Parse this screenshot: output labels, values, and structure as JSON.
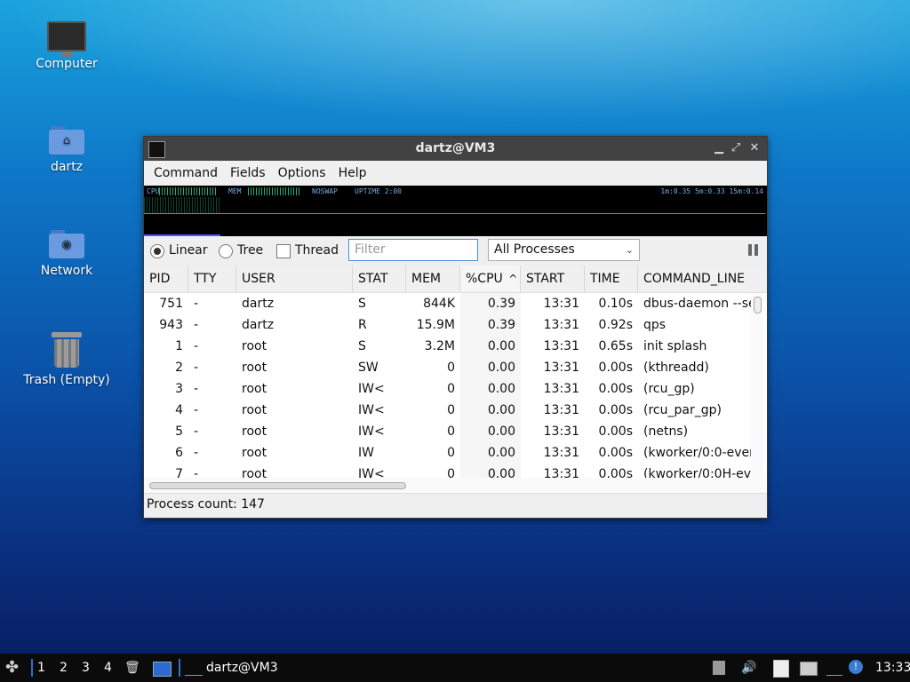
{
  "desktop": {
    "icons": [
      {
        "label": "Computer",
        "icon": "computer-icon"
      },
      {
        "label": "dartz",
        "icon": "home-folder-icon"
      },
      {
        "label": "Network",
        "icon": "network-folder-icon"
      },
      {
        "label": "Trash (Empty)",
        "icon": "trash-icon"
      }
    ]
  },
  "window": {
    "title": "dartz@VM3",
    "controls": {
      "minimize": "▁",
      "maximize": "⤢",
      "close": "✕"
    },
    "menu": [
      "Command",
      "Fields",
      "Options",
      "Help"
    ],
    "graph": {
      "cpu_label": "CPU",
      "mem_label": "MEM",
      "swap_label": "NOSWAP",
      "uptime": "UPTIME 2:00",
      "load": "1m:0.35 5m:0.33 15m:0.14"
    },
    "toolbar": {
      "linear": "Linear",
      "tree": "Tree",
      "thread": "Thread",
      "filter_placeholder": "Filter",
      "process_select": "All Processes",
      "view_mode": "Linear"
    },
    "columns": [
      "PID",
      "TTY",
      "USER",
      "STAT",
      "MEM",
      "%CPU",
      "START",
      "TIME",
      "COMMAND_LINE"
    ],
    "sort_indicator": "^",
    "rows": [
      {
        "pid": "751",
        "tty": "-",
        "user": "dartz",
        "stat": "S",
        "mem": "844K",
        "cpu": "0.39",
        "start": "13:31",
        "time": "0.10s",
        "cmd": "dbus-daemon --se"
      },
      {
        "pid": "943",
        "tty": "-",
        "user": "dartz",
        "stat": "R",
        "mem": "15.9M",
        "cpu": "0.39",
        "start": "13:31",
        "time": "0.92s",
        "cmd": "qps"
      },
      {
        "pid": "1",
        "tty": "-",
        "user": "root",
        "stat": "S",
        "mem": "3.2M",
        "cpu": "0.00",
        "start": "13:31",
        "time": "0.65s",
        "cmd": "init splash"
      },
      {
        "pid": "2",
        "tty": "-",
        "user": "root",
        "stat": "SW",
        "mem": "0",
        "cpu": "0.00",
        "start": "13:31",
        "time": "0.00s",
        "cmd": "(kthreadd)"
      },
      {
        "pid": "3",
        "tty": "-",
        "user": "root",
        "stat": "IW<",
        "mem": "0",
        "cpu": "0.00",
        "start": "13:31",
        "time": "0.00s",
        "cmd": "(rcu_gp)"
      },
      {
        "pid": "4",
        "tty": "-",
        "user": "root",
        "stat": "IW<",
        "mem": "0",
        "cpu": "0.00",
        "start": "13:31",
        "time": "0.00s",
        "cmd": "(rcu_par_gp)"
      },
      {
        "pid": "5",
        "tty": "-",
        "user": "root",
        "stat": "IW<",
        "mem": "0",
        "cpu": "0.00",
        "start": "13:31",
        "time": "0.00s",
        "cmd": "(netns)"
      },
      {
        "pid": "6",
        "tty": "-",
        "user": "root",
        "stat": "IW",
        "mem": "0",
        "cpu": "0.00",
        "start": "13:31",
        "time": "0.00s",
        "cmd": "(kworker/0:0-ever"
      },
      {
        "pid": "7",
        "tty": "-",
        "user": "root",
        "stat": "IW<",
        "mem": "0",
        "cpu": "0.00",
        "start": "13:31",
        "time": "0.00s",
        "cmd": "(kworker/0:0H-ev"
      }
    ],
    "status": "Process count: 147"
  },
  "taskbar": {
    "workspaces": [
      "1",
      "2",
      "3",
      "4"
    ],
    "task_label": "dartz@VM3",
    "clock": "13:33"
  }
}
